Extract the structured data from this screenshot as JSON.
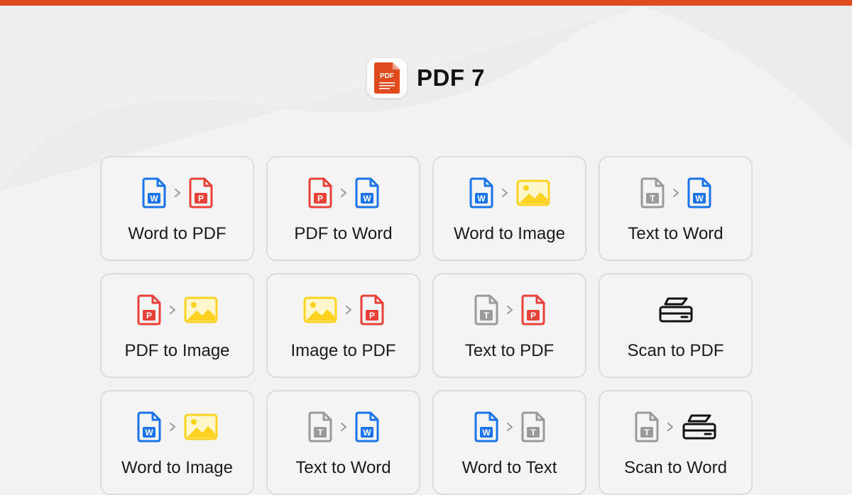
{
  "colors": {
    "accent": "#e04a1c",
    "word": "#1a73e8",
    "pdf": "#e8413a",
    "image": "#ffd21f",
    "text": "#9a9a9a",
    "scan": "#111111"
  },
  "header": {
    "app_name": "PDF 7",
    "logo_text": "PDF",
    "logo_icon": "pdf-app-icon"
  },
  "tools": [
    {
      "label": "Word to PDF",
      "from": "word",
      "to": "pdf"
    },
    {
      "label": "PDF to Word",
      "from": "pdf",
      "to": "word"
    },
    {
      "label": "Word to Image",
      "from": "word",
      "to": "image"
    },
    {
      "label": "Text to Word",
      "from": "text",
      "to": "word"
    },
    {
      "label": "PDF to Image",
      "from": "pdf",
      "to": "image"
    },
    {
      "label": "Image to PDF",
      "from": "image",
      "to": "pdf"
    },
    {
      "label": "Text to PDF",
      "from": "text",
      "to": "pdf"
    },
    {
      "label": "Scan to PDF",
      "from": "scan",
      "to": null
    },
    {
      "label": "Word to Image",
      "from": "word",
      "to": "image"
    },
    {
      "label": "Text to Word",
      "from": "text",
      "to": "word"
    },
    {
      "label": "Word to Text",
      "from": "word",
      "to": "text"
    },
    {
      "label": "Scan to Word",
      "from": "text",
      "to": "scan"
    }
  ]
}
